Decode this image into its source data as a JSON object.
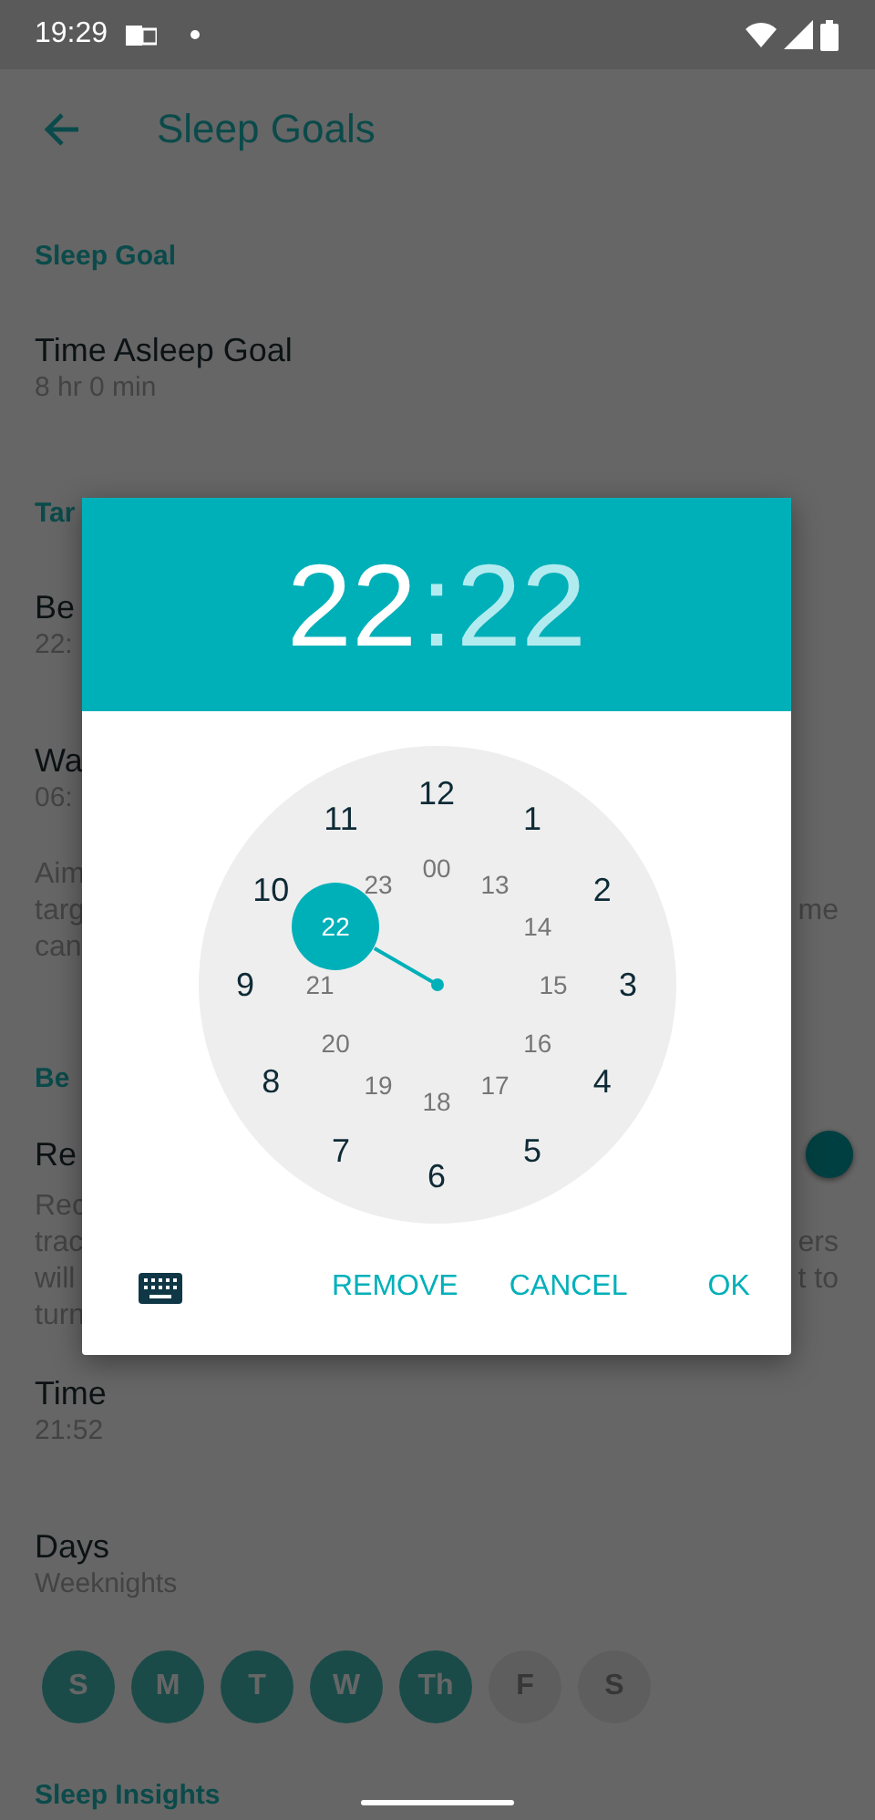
{
  "status_bar": {
    "time": "19:29"
  },
  "header": {
    "title": "Sleep Goals"
  },
  "sleep_goal": {
    "heading": "Sleep Goal",
    "label": "Time Asleep Goal",
    "value": "8 hr 0 min"
  },
  "target": {
    "heading": "Tar",
    "rows": [
      {
        "label": "Be",
        "value": "22:"
      },
      {
        "label": "Wa",
        "value": "06:"
      }
    ],
    "note_lines": [
      {
        "left": "Aim"
      },
      {
        "left": "targ",
        "right": "me"
      },
      {
        "left": "can"
      }
    ]
  },
  "reminder": {
    "heading": "Be",
    "label": "Re",
    "on": true,
    "note_lines": [
      {
        "left": "Rec"
      },
      {
        "left": "trac",
        "right": "ers"
      },
      {
        "left": "will",
        "right": "t to"
      },
      {
        "left": "turn"
      }
    ],
    "time_label": "Time",
    "time_value": "21:52",
    "days_label": "Days",
    "days_value": "Weeknights",
    "days": [
      {
        "label": "S",
        "selected": true
      },
      {
        "label": "M",
        "selected": true
      },
      {
        "label": "T",
        "selected": true
      },
      {
        "label": "W",
        "selected": true
      },
      {
        "label": "Th",
        "selected": true
      },
      {
        "label": "F",
        "selected": false
      },
      {
        "label": "S",
        "selected": false
      }
    ]
  },
  "next_heading": "Sleep Insights",
  "dialog": {
    "hours": {
      "text": "22",
      "selected": true
    },
    "separator": ":",
    "minutes": {
      "text": "22",
      "selected": false
    },
    "outer_numbers": [
      {
        "label": "12",
        "selected": false
      },
      {
        "label": "1",
        "selected": false
      },
      {
        "label": "2",
        "selected": false
      },
      {
        "label": "3",
        "selected": false
      },
      {
        "label": "4",
        "selected": false
      },
      {
        "label": "5",
        "selected": false
      },
      {
        "label": "6",
        "selected": false
      },
      {
        "label": "7",
        "selected": false
      },
      {
        "label": "8",
        "selected": false
      },
      {
        "label": "9",
        "selected": false
      },
      {
        "label": "10",
        "selected": false
      },
      {
        "label": "11",
        "selected": false
      }
    ],
    "inner_numbers": [
      {
        "label": "00",
        "selected": false
      },
      {
        "label": "13",
        "selected": false
      },
      {
        "label": "14",
        "selected": false
      },
      {
        "label": "15",
        "selected": false
      },
      {
        "label": "16",
        "selected": false
      },
      {
        "label": "17",
        "selected": false
      },
      {
        "label": "18",
        "selected": false
      },
      {
        "label": "19",
        "selected": false
      },
      {
        "label": "20",
        "selected": false
      },
      {
        "label": "21",
        "selected": false
      },
      {
        "label": "22",
        "selected": true
      },
      {
        "label": "23",
        "selected": false
      }
    ],
    "buttons": [
      "REMOVE",
      "CANCEL",
      "OK"
    ]
  }
}
